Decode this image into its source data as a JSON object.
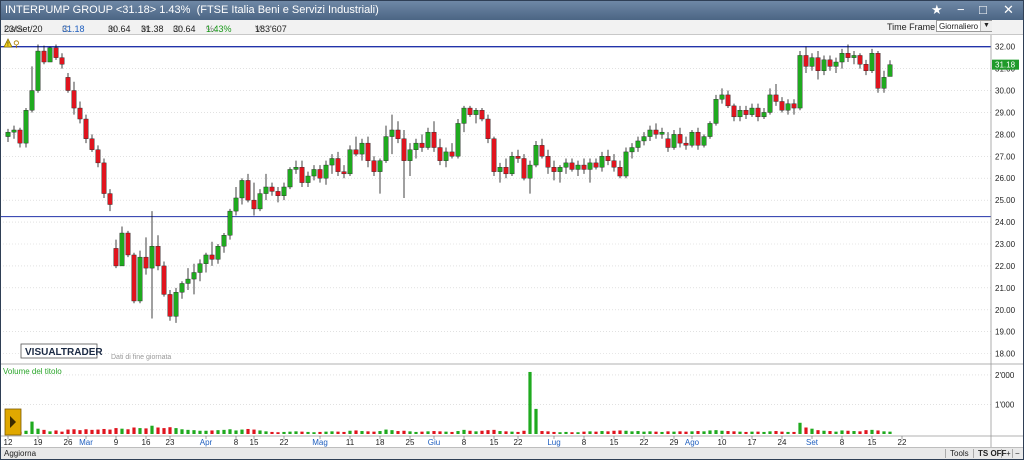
{
  "window": {
    "title": "INTERPUMP GROUP <31.18> 1.43%  (FTSE Italia Beni e Servizi Industriali)",
    "star": "★",
    "minimize": "−",
    "maximize": "□",
    "close": "✕"
  },
  "info": {
    "data_label": "Data:",
    "data_value": "23/Set/20",
    "c_label": "C:",
    "c_value": "31.18",
    "m_label": "m:",
    "m_value": "30.64",
    "M_label": "M:",
    "M_value": "31.38",
    "o_label": "O:",
    "o_value": "30.64",
    "pct_label": "%:",
    "pct_value": "1.43%",
    "v_label": "V:",
    "v_value": "183'607",
    "timeframe_label": "Time Frame",
    "timeframe_value": "Giornaliero"
  },
  "watermark": {
    "brand": "VISUALTRADER",
    "note": "Dati di fine giornata"
  },
  "status": {
    "left": "Aggiorna",
    "tools": "Tools",
    "ts": "TS OFF",
    "plus": "+",
    "minus": "−"
  },
  "chart_data": {
    "type": "candlestick",
    "price_axis": {
      "ylim": [
        17.8,
        32.35
      ],
      "ticks": [
        "32.00",
        "31.00",
        "30.00",
        "29.00",
        "28.00",
        "27.00",
        "26.00",
        "25.00",
        "24.00",
        "23.00",
        "22.00",
        "21.00",
        "20.00",
        "19.00",
        "18.00"
      ]
    },
    "last_price": "31.18",
    "horizontal_lines": [
      32.0,
      24.25
    ],
    "x_labels": [
      {
        "i": 0,
        "t": "12",
        "month": false
      },
      {
        "i": 5,
        "t": "19",
        "month": false
      },
      {
        "i": 10,
        "t": "26",
        "month": false
      },
      {
        "i": 13,
        "t": "Mar",
        "month": true
      },
      {
        "i": 18,
        "t": "9",
        "month": false
      },
      {
        "i": 23,
        "t": "16",
        "month": false
      },
      {
        "i": 27,
        "t": "23",
        "month": false
      },
      {
        "i": 33,
        "t": "Apr",
        "month": true
      },
      {
        "i": 38,
        "t": "8",
        "month": false
      },
      {
        "i": 41,
        "t": "15",
        "month": false
      },
      {
        "i": 46,
        "t": "22",
        "month": false
      },
      {
        "i": 52,
        "t": "Mag",
        "month": true
      },
      {
        "i": 57,
        "t": "11",
        "month": false
      },
      {
        "i": 62,
        "t": "18",
        "month": false
      },
      {
        "i": 67,
        "t": "25",
        "month": false
      },
      {
        "i": 71,
        "t": "Giu",
        "month": true
      },
      {
        "i": 76,
        "t": "8",
        "month": false
      },
      {
        "i": 81,
        "t": "15",
        "month": false
      },
      {
        "i": 85,
        "t": "22",
        "month": false
      },
      {
        "i": 91,
        "t": "Lug",
        "month": true
      },
      {
        "i": 96,
        "t": "8",
        "month": false
      },
      {
        "i": 101,
        "t": "15",
        "month": false
      },
      {
        "i": 106,
        "t": "22",
        "month": false
      },
      {
        "i": 111,
        "t": "29",
        "month": false
      },
      {
        "i": 114,
        "t": "Ago",
        "month": true
      },
      {
        "i": 119,
        "t": "10",
        "month": false
      },
      {
        "i": 124,
        "t": "17",
        "month": false
      },
      {
        "i": 129,
        "t": "24",
        "month": false
      },
      {
        "i": 134,
        "t": "Set",
        "month": true
      },
      {
        "i": 139,
        "t": "8",
        "month": false
      },
      {
        "i": 144,
        "t": "15",
        "month": false
      },
      {
        "i": 149,
        "t": "22",
        "month": false
      }
    ],
    "volume_panel": {
      "label": "Volume del titolo",
      "ylim": [
        0,
        2200000
      ],
      "ticks": [
        "2'000",
        "1'000"
      ]
    },
    "candles": [
      [
        27.9,
        28.25,
        27.65,
        28.1,
        60
      ],
      [
        28.1,
        28.4,
        27.8,
        28.2,
        55
      ],
      [
        28.2,
        28.3,
        27.4,
        27.6,
        75
      ],
      [
        27.6,
        29.2,
        27.4,
        29.1,
        110
      ],
      [
        29.1,
        31.1,
        29.0,
        30.0,
        420
      ],
      [
        30.0,
        32.1,
        29.9,
        31.8,
        180
      ],
      [
        31.8,
        32.05,
        31.2,
        31.3,
        140
      ],
      [
        31.3,
        32.0,
        31.3,
        31.95,
        90
      ],
      [
        31.95,
        32.1,
        31.4,
        31.5,
        120
      ],
      [
        31.5,
        31.7,
        31.0,
        31.2,
        80
      ],
      [
        30.6,
        30.8,
        29.9,
        30.0,
        150
      ],
      [
        30.0,
        30.4,
        28.9,
        29.2,
        160
      ],
      [
        29.2,
        29.5,
        28.5,
        28.7,
        130
      ],
      [
        28.7,
        28.9,
        27.6,
        27.8,
        160
      ],
      [
        27.8,
        28.0,
        27.2,
        27.3,
        140
      ],
      [
        27.3,
        27.5,
        26.5,
        26.7,
        150
      ],
      [
        26.7,
        26.9,
        25.1,
        25.3,
        170
      ],
      [
        25.3,
        25.5,
        24.5,
        24.8,
        150
      ],
      [
        22.8,
        23.2,
        21.9,
        22.0,
        200
      ],
      [
        22.0,
        23.8,
        22.0,
        23.5,
        180
      ],
      [
        23.5,
        23.6,
        22.4,
        22.5,
        160
      ],
      [
        22.5,
        22.6,
        20.3,
        20.4,
        220
      ],
      [
        20.4,
        22.7,
        20.3,
        22.4,
        200
      ],
      [
        22.4,
        23.3,
        21.6,
        21.9,
        190
      ],
      [
        21.9,
        24.5,
        19.6,
        22.9,
        280
      ],
      [
        22.9,
        23.4,
        21.8,
        22.0,
        220
      ],
      [
        22.0,
        22.2,
        20.6,
        20.7,
        200
      ],
      [
        20.7,
        20.9,
        19.5,
        19.7,
        230
      ],
      [
        19.7,
        21.0,
        19.4,
        20.8,
        200
      ],
      [
        20.8,
        21.3,
        20.5,
        21.2,
        160
      ],
      [
        21.2,
        21.9,
        20.9,
        21.4,
        140
      ],
      [
        21.4,
        22.1,
        20.7,
        21.7,
        130
      ],
      [
        21.7,
        22.3,
        21.3,
        22.1,
        110
      ],
      [
        22.1,
        22.6,
        21.7,
        22.5,
        110
      ],
      [
        22.5,
        23.1,
        22.0,
        22.3,
        120
      ],
      [
        22.3,
        23.0,
        22.1,
        22.9,
        130
      ],
      [
        22.9,
        23.5,
        22.6,
        23.4,
        140
      ],
      [
        23.4,
        24.6,
        23.2,
        24.5,
        160
      ],
      [
        24.5,
        25.6,
        24.3,
        25.1,
        120
      ],
      [
        25.1,
        26.0,
        24.8,
        25.9,
        150
      ],
      [
        25.9,
        26.2,
        24.9,
        25.0,
        170
      ],
      [
        25.0,
        25.8,
        24.3,
        24.6,
        150
      ],
      [
        24.6,
        25.5,
        24.5,
        25.3,
        120
      ],
      [
        25.3,
        26.2,
        25.0,
        25.6,
        90
      ],
      [
        25.6,
        25.8,
        25.2,
        25.4,
        70
      ],
      [
        25.4,
        25.6,
        24.9,
        25.2,
        60
      ],
      [
        25.2,
        25.8,
        25.0,
        25.6,
        70
      ],
      [
        25.6,
        26.5,
        25.5,
        26.4,
        80
      ],
      [
        26.4,
        26.8,
        26.2,
        26.5,
        90
      ],
      [
        26.5,
        26.8,
        25.6,
        25.8,
        80
      ],
      [
        25.8,
        26.3,
        25.6,
        26.1,
        70
      ],
      [
        26.1,
        26.6,
        25.9,
        26.4,
        60
      ],
      [
        26.4,
        26.6,
        25.8,
        26.0,
        70
      ],
      [
        26.0,
        26.8,
        25.7,
        26.6,
        80
      ],
      [
        26.6,
        27.1,
        26.2,
        26.9,
        90
      ],
      [
        26.9,
        27.2,
        26.1,
        26.3,
        80
      ],
      [
        26.3,
        26.6,
        26.0,
        26.2,
        70
      ],
      [
        26.2,
        27.5,
        26.1,
        27.3,
        110
      ],
      [
        27.3,
        27.9,
        27.0,
        27.1,
        120
      ],
      [
        27.1,
        27.8,
        26.8,
        27.6,
        100
      ],
      [
        27.6,
        27.9,
        26.5,
        26.8,
        90
      ],
      [
        26.8,
        27.0,
        26.1,
        26.3,
        80
      ],
      [
        26.3,
        26.9,
        25.3,
        26.8,
        100
      ],
      [
        26.8,
        28.4,
        26.7,
        27.9,
        150
      ],
      [
        27.9,
        28.9,
        27.1,
        28.2,
        130
      ],
      [
        28.2,
        28.6,
        27.6,
        27.8,
        100
      ],
      [
        27.8,
        28.2,
        25.1,
        26.8,
        110
      ],
      [
        26.8,
        27.6,
        26.1,
        27.3,
        90
      ],
      [
        27.3,
        27.8,
        26.9,
        27.6,
        70
      ],
      [
        27.6,
        28.0,
        27.2,
        27.4,
        80
      ],
      [
        27.4,
        28.3,
        27.3,
        28.1,
        90
      ],
      [
        28.1,
        28.6,
        27.2,
        27.4,
        100
      ],
      [
        27.4,
        27.8,
        26.6,
        26.8,
        90
      ],
      [
        26.8,
        27.4,
        26.5,
        27.2,
        80
      ],
      [
        27.2,
        27.6,
        26.9,
        27.0,
        70
      ],
      [
        27.0,
        28.7,
        26.9,
        28.5,
        100
      ],
      [
        28.5,
        29.3,
        28.1,
        29.2,
        140
      ],
      [
        29.2,
        29.3,
        28.8,
        28.9,
        110
      ],
      [
        28.9,
        29.2,
        28.5,
        29.1,
        90
      ],
      [
        29.1,
        29.2,
        28.6,
        28.7,
        110
      ],
      [
        28.7,
        28.9,
        27.6,
        27.8,
        130
      ],
      [
        27.8,
        27.9,
        26.1,
        26.3,
        140
      ],
      [
        26.3,
        26.7,
        25.8,
        26.5,
        100
      ],
      [
        26.5,
        26.9,
        26.0,
        26.2,
        90
      ],
      [
        26.2,
        27.2,
        26.1,
        27.0,
        80
      ],
      [
        27.0,
        27.3,
        26.7,
        26.9,
        70
      ],
      [
        26.9,
        27.1,
        25.9,
        26.0,
        110
      ],
      [
        26.0,
        26.8,
        25.3,
        26.6,
        2100
      ],
      [
        26.6,
        27.7,
        26.5,
        27.5,
        850
      ],
      [
        27.5,
        27.8,
        26.9,
        27.0,
        100
      ],
      [
        27.0,
        27.3,
        26.2,
        26.5,
        90
      ],
      [
        26.5,
        26.8,
        25.9,
        26.3,
        70
      ],
      [
        26.3,
        26.6,
        25.8,
        26.5,
        60
      ],
      [
        26.5,
        26.9,
        26.2,
        26.7,
        70
      ],
      [
        26.7,
        26.9,
        26.3,
        26.4,
        60
      ],
      [
        26.4,
        26.8,
        26.1,
        26.6,
        60
      ],
      [
        26.6,
        26.9,
        26.2,
        26.4,
        80
      ],
      [
        26.4,
        26.9,
        25.8,
        26.7,
        90
      ],
      [
        26.7,
        26.9,
        26.4,
        26.5,
        80
      ],
      [
        26.5,
        27.2,
        26.3,
        27.0,
        100
      ],
      [
        27.0,
        27.3,
        26.6,
        26.8,
        90
      ],
      [
        26.8,
        27.1,
        26.3,
        26.5,
        110
      ],
      [
        26.5,
        26.8,
        26.0,
        26.1,
        120
      ],
      [
        26.1,
        27.4,
        26.0,
        27.2,
        110
      ],
      [
        27.2,
        27.6,
        26.9,
        27.4,
        90
      ],
      [
        27.4,
        27.9,
        27.2,
        27.7,
        100
      ],
      [
        27.7,
        28.1,
        27.5,
        27.9,
        80
      ],
      [
        27.9,
        28.4,
        27.7,
        28.2,
        90
      ],
      [
        28.2,
        28.5,
        27.8,
        28.0,
        80
      ],
      [
        28.0,
        28.3,
        27.8,
        28.1,
        70
      ],
      [
        27.8,
        28.1,
        27.2,
        27.4,
        90
      ],
      [
        27.4,
        28.2,
        27.3,
        28.0,
        80
      ],
      [
        28.0,
        28.3,
        27.4,
        27.6,
        90
      ],
      [
        27.6,
        27.9,
        27.3,
        27.5,
        80
      ],
      [
        27.5,
        28.2,
        27.4,
        28.1,
        90
      ],
      [
        28.1,
        28.3,
        27.3,
        27.5,
        100
      ],
      [
        27.5,
        28.0,
        27.4,
        27.9,
        90
      ],
      [
        27.9,
        28.6,
        27.8,
        28.5,
        120
      ],
      [
        28.5,
        29.8,
        28.4,
        29.6,
        130
      ],
      [
        29.6,
        30.1,
        29.4,
        29.8,
        110
      ],
      [
        29.8,
        30.0,
        29.2,
        29.3,
        100
      ],
      [
        29.3,
        29.4,
        28.6,
        28.8,
        90
      ],
      [
        28.8,
        29.3,
        28.6,
        29.1,
        80
      ],
      [
        29.1,
        29.3,
        28.7,
        28.9,
        70
      ],
      [
        28.9,
        29.4,
        28.8,
        29.2,
        80
      ],
      [
        29.2,
        29.4,
        28.6,
        28.8,
        80
      ],
      [
        28.8,
        29.2,
        28.7,
        29.0,
        70
      ],
      [
        29.0,
        30.1,
        28.9,
        29.8,
        90
      ],
      [
        29.8,
        30.3,
        29.3,
        29.5,
        100
      ],
      [
        29.5,
        29.7,
        29.0,
        29.1,
        80
      ],
      [
        29.1,
        29.6,
        28.9,
        29.4,
        70
      ],
      [
        29.4,
        29.6,
        28.9,
        29.2,
        70
      ],
      [
        29.2,
        31.8,
        29.1,
        31.6,
        380
      ],
      [
        31.6,
        32.0,
        30.8,
        31.1,
        220
      ],
      [
        31.1,
        31.7,
        30.9,
        31.5,
        180
      ],
      [
        31.5,
        31.8,
        30.5,
        30.9,
        130
      ],
      [
        30.9,
        31.6,
        30.7,
        31.4,
        110
      ],
      [
        31.4,
        31.6,
        30.9,
        31.1,
        100
      ],
      [
        31.1,
        31.5,
        30.8,
        31.3,
        80
      ],
      [
        31.3,
        31.9,
        31.0,
        31.7,
        120
      ],
      [
        31.7,
        32.1,
        31.3,
        31.5,
        110
      ],
      [
        31.5,
        31.8,
        31.2,
        31.6,
        100
      ],
      [
        31.6,
        31.7,
        31.0,
        31.2,
        90
      ],
      [
        31.2,
        31.4,
        30.7,
        30.9,
        130
      ],
      [
        30.9,
        31.9,
        30.8,
        31.7,
        140
      ],
      [
        31.7,
        31.8,
        29.9,
        30.1,
        120
      ],
      [
        30.1,
        30.9,
        29.9,
        30.6,
        90
      ],
      [
        30.64,
        31.38,
        30.64,
        31.18,
        80
      ]
    ]
  }
}
